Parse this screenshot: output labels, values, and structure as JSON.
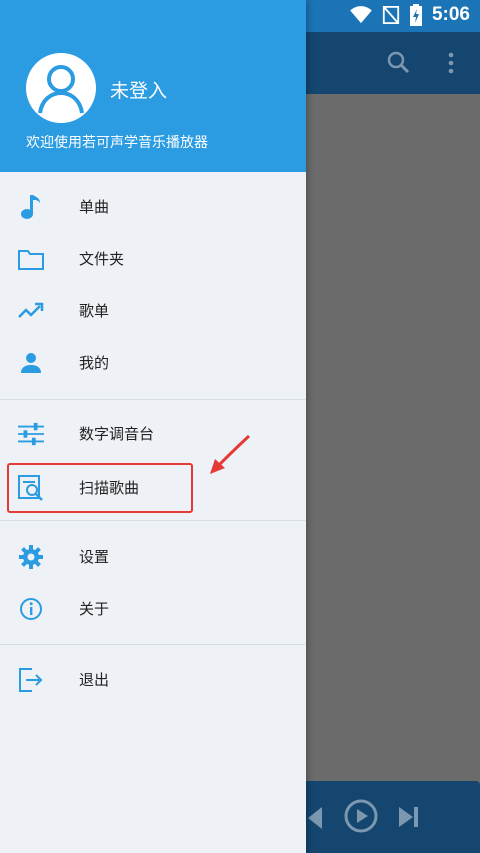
{
  "status_bar": {
    "time": "5:06"
  },
  "drawer": {
    "user_status": "未登入",
    "welcome_text": "欢迎使用若可声学音乐播放器",
    "items": [
      {
        "label": "单曲",
        "icon": "music-note-icon"
      },
      {
        "label": "文件夹",
        "icon": "folder-icon"
      },
      {
        "label": "歌单",
        "icon": "trending-icon"
      },
      {
        "label": "我的",
        "icon": "person-icon"
      },
      {
        "label": "数字调音台",
        "icon": "equalizer-icon"
      },
      {
        "label": "扫描歌曲",
        "icon": "scan-icon"
      },
      {
        "label": "设置",
        "icon": "gear-icon"
      },
      {
        "label": "关于",
        "icon": "info-icon"
      },
      {
        "label": "退出",
        "icon": "exit-icon"
      }
    ]
  },
  "colors": {
    "accent": "#2b9be2",
    "highlight_box": "#e53935"
  }
}
